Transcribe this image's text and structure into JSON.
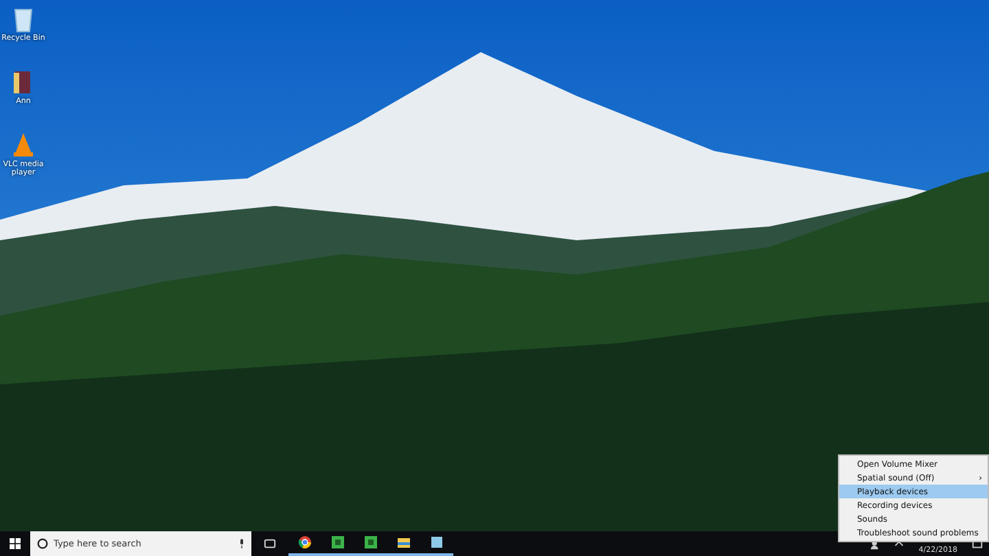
{
  "desktop_icons": [
    {
      "kind": "recycle-bin",
      "label": "Recycle Bin"
    },
    {
      "kind": "folder",
      "label": "Ann"
    },
    {
      "kind": "vlc",
      "label": "VLC media player"
    }
  ],
  "context_menu": {
    "items": [
      {
        "label": "Open Volume Mixer",
        "selected": false,
        "submenu": false
      },
      {
        "label": "Spatial sound (Off)",
        "selected": false,
        "submenu": true
      },
      {
        "label": "Playback devices",
        "selected": true,
        "submenu": false
      },
      {
        "label": "Recording devices",
        "selected": false,
        "submenu": false
      },
      {
        "label": "Sounds",
        "selected": false,
        "submenu": false
      },
      {
        "label": "Troubleshoot sound problems",
        "selected": false,
        "submenu": false
      }
    ],
    "submenu_arrow": "›"
  },
  "taskbar": {
    "search": {
      "placeholder": "Type here to search"
    },
    "apps": [
      {
        "kind": "browser",
        "running": true
      },
      {
        "kind": "green-app",
        "running": true
      },
      {
        "kind": "green-app",
        "running": true
      },
      {
        "kind": "folder",
        "running": true
      },
      {
        "kind": "app",
        "running": true
      }
    ],
    "date": "4/22/2018"
  }
}
